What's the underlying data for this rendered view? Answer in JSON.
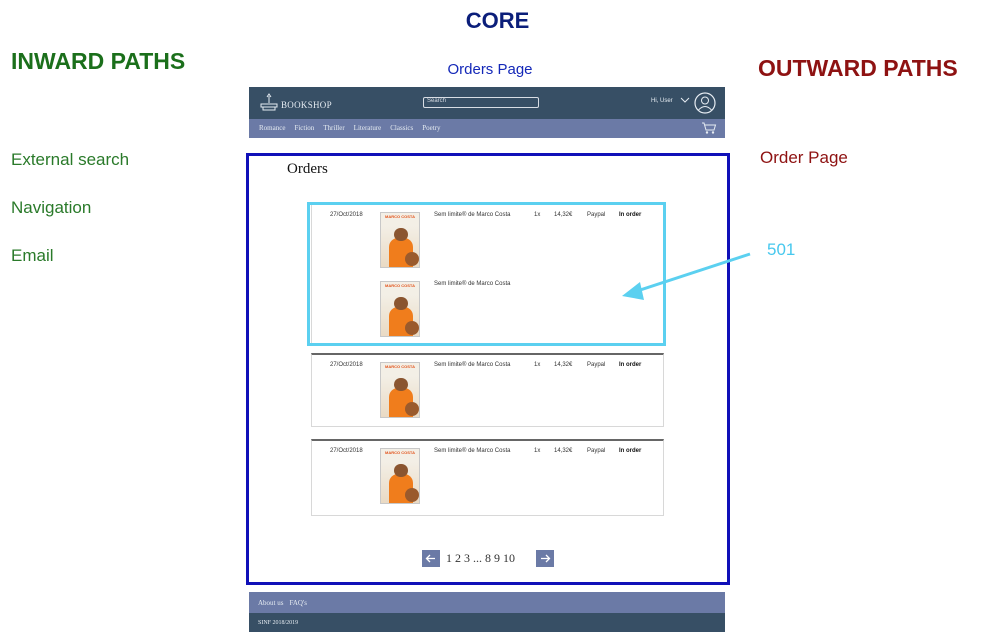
{
  "core_title": "CORE",
  "page_caption": "Orders Page",
  "inward": {
    "title": "INWARD PATHS",
    "items": [
      "External search",
      "Navigation",
      "Email"
    ]
  },
  "outward": {
    "title": "OUTWARD PATHS",
    "items": [
      "Order Page"
    ]
  },
  "annotation": {
    "code": "501",
    "color": "#5bd0f0"
  },
  "mockup": {
    "header": {
      "logo_text": "BOOKSHOP",
      "search_placeholder": "Search",
      "user_name": "Hi, User",
      "nav": [
        "Romance",
        "Fiction",
        "Thriller",
        "Literature",
        "Classics",
        "Poetry"
      ]
    },
    "page_title": "Orders",
    "orders": [
      {
        "date": "27/Oct/2018",
        "items": [
          {
            "title": "Sem limite® de Marco Costa",
            "qty": "1x",
            "price": "14,32€",
            "payment": "Paypal",
            "status": "In order",
            "cover_title": "MARCO COSTA"
          },
          {
            "title": "Sem limite® de Marco Costa",
            "cover_title": "MARCO COSTA"
          }
        ]
      },
      {
        "date": "27/Oct/2018",
        "items": [
          {
            "title": "Sem limite® de Marco Costa",
            "qty": "1x",
            "price": "14,32€",
            "payment": "Paypal",
            "status": "In order",
            "cover_title": "MARCO COSTA"
          }
        ]
      },
      {
        "date": "27/Oct/2018",
        "items": [
          {
            "title": "Sem limite® de Marco Costa",
            "qty": "1x",
            "price": "14,32€",
            "payment": "Paypal",
            "status": "In order",
            "cover_title": "MARCO COSTA"
          }
        ]
      }
    ],
    "pagination": {
      "text": "1 2 3 ... 8 9 10"
    },
    "footer": {
      "links": [
        "About us",
        "FAQ's"
      ],
      "copyright": "SINF 2018/2019"
    }
  },
  "colors": {
    "header_dark": "#374f65",
    "header_light": "#6b7aa6",
    "core_frame": "#1010b8",
    "inward": "#1b6f1b",
    "outward": "#8e1212"
  }
}
